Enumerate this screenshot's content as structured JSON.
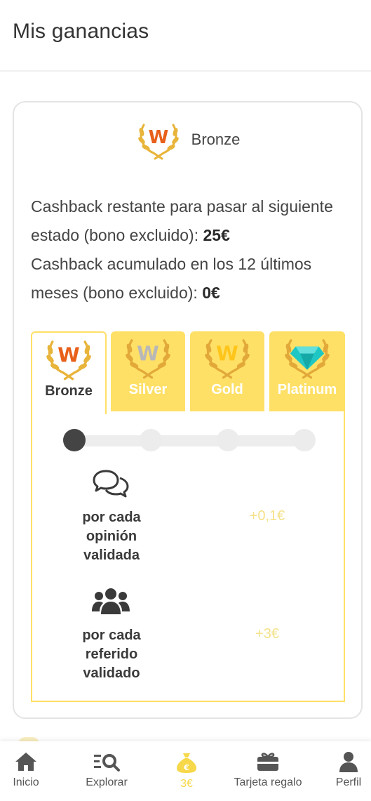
{
  "header": {
    "title": "Mis ganancias"
  },
  "status": {
    "current_name": "Bronze",
    "remaining_text": "Cashback restante para pasar al siguiente estado (bono excluido): ",
    "remaining_value": "25€",
    "accumulated_text": "Cashback acumulado en los 12 últimos meses (bono excluido): ",
    "accumulated_value": "0€"
  },
  "tiers": [
    {
      "name": "Bronze",
      "active": true
    },
    {
      "name": "Silver",
      "active": false
    },
    {
      "name": "Gold",
      "active": false
    },
    {
      "name": "Platinum",
      "active": false
    }
  ],
  "progress": {
    "current_step": 1,
    "total_steps": 4
  },
  "rewards": [
    {
      "icon": "comments-icon",
      "label": "por cada opinión validada",
      "value": "+0,1€"
    },
    {
      "icon": "users-icon",
      "label": "por cada referido validado",
      "value": "+3€"
    }
  ],
  "bottom_nav": [
    {
      "icon": "home-icon",
      "label": "Inicio",
      "active": false
    },
    {
      "icon": "explore-icon",
      "label": "Explorar",
      "active": false
    },
    {
      "icon": "money-bag-icon",
      "label": "3€",
      "active": true
    },
    {
      "icon": "gift-card-icon",
      "label": "Tarjeta regalo",
      "active": false
    },
    {
      "icon": "user-icon",
      "label": "Perfil",
      "active": false
    }
  ],
  "colors": {
    "accent_yellow": "#ffe066",
    "bronze": "#e8601a",
    "silver": "#b8b8b8",
    "gold": "#ffd23f",
    "platinum": "#1fc7c4",
    "laurel": "#e8b43a"
  }
}
